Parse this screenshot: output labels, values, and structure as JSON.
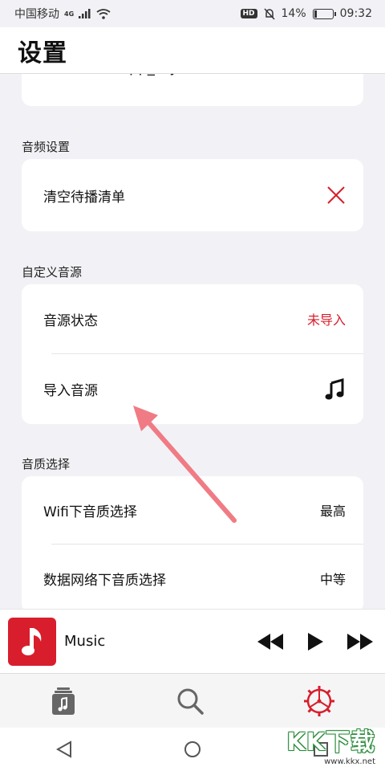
{
  "status_bar": {
    "carrier": "中国移动",
    "network": "4G",
    "hd": "HD",
    "battery": "14%",
    "battery_level": 0.14,
    "time": "09:32"
  },
  "header": {
    "title": "设置"
  },
  "partial_card": {
    "value": "app_rhyme"
  },
  "audio_settings": {
    "label": "音频设置",
    "clear_queue": "清空待播清单"
  },
  "custom_source": {
    "label": "自定义音源",
    "status_label": "音源状态",
    "status_value": "未导入",
    "import_label": "导入音源"
  },
  "quality": {
    "label": "音质选择",
    "wifi_label": "Wifi下音质选择",
    "wifi_value": "最高",
    "mobile_label": "数据网络下音质选择",
    "mobile_value": "中等"
  },
  "player": {
    "title": "Music"
  },
  "watermark": {
    "main": "KK下载",
    "url": "www.kkx.net"
  },
  "colors": {
    "accent": "#d81e2c",
    "arrow": "#f07b84"
  }
}
